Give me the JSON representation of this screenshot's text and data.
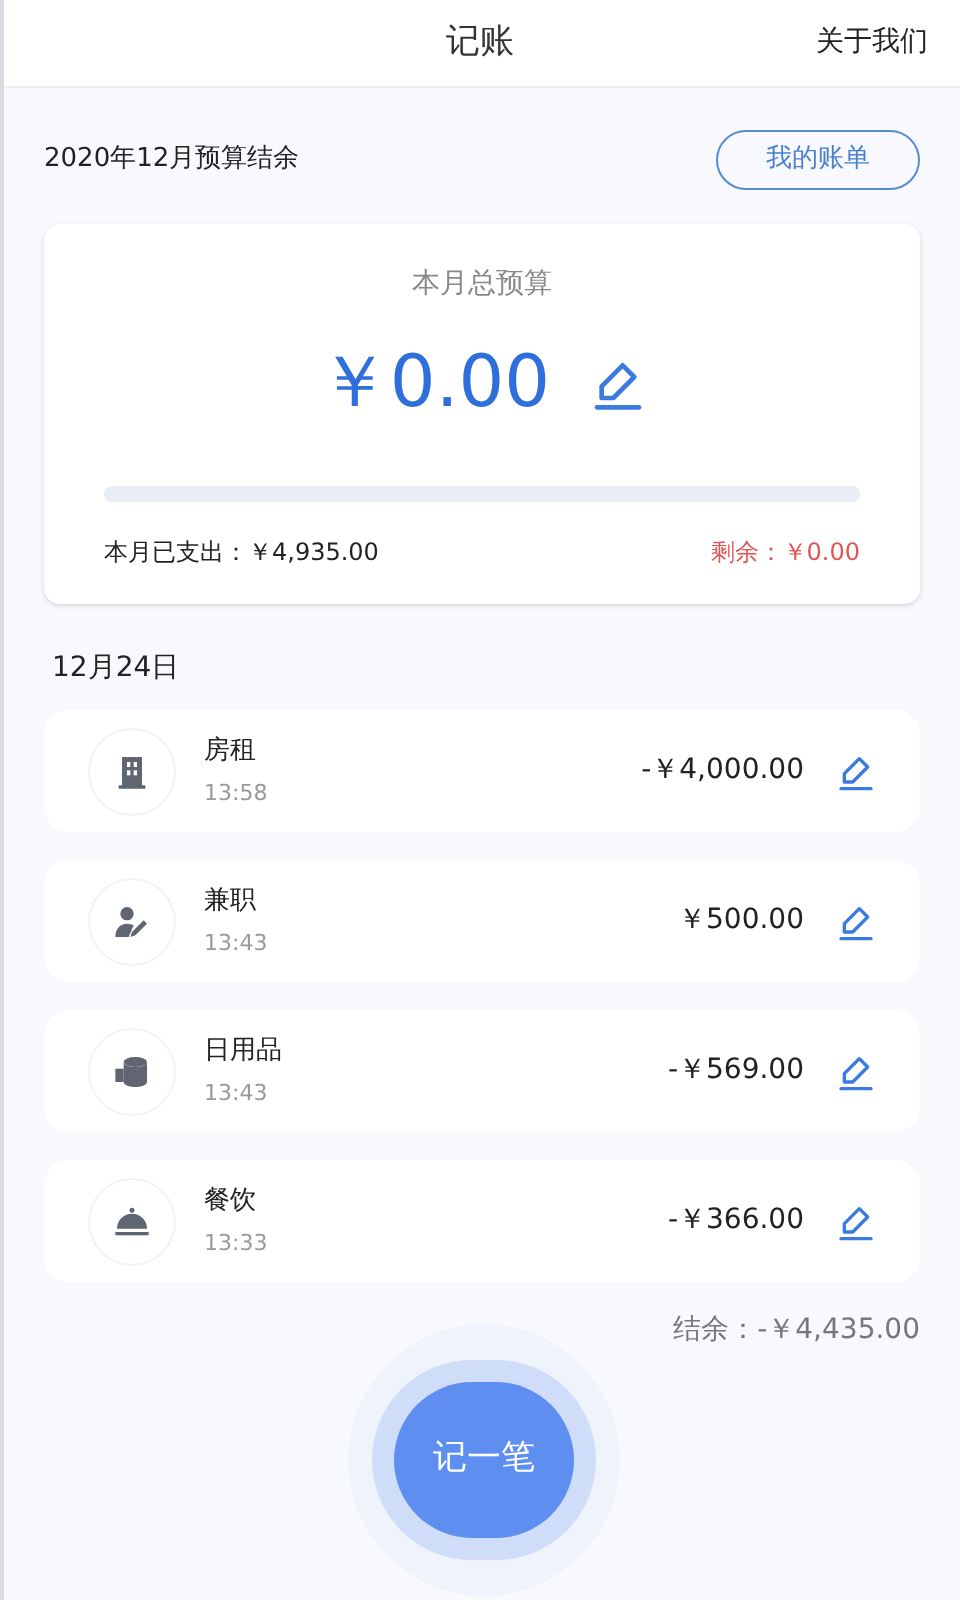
{
  "header": {
    "title": "记账",
    "link": "关于我们"
  },
  "summary": {
    "title": "2020年12月预算结余",
    "bills_button": "我的账单"
  },
  "budget": {
    "label": "本月总预算",
    "amount": "￥0.00",
    "level": 0,
    "spent": "本月已支出：￥4,935.00",
    "remaining": "剩余：￥0.00"
  },
  "day": {
    "date": "12月24日",
    "entries": [
      {
        "kind": "building",
        "name": "房租",
        "time": "13:58",
        "amount": "-￥4,000.00"
      },
      {
        "kind": "person",
        "name": "兼职",
        "time": "13:43",
        "amount": "￥500.00"
      },
      {
        "kind": "roll",
        "name": "日用品",
        "time": "13:43",
        "amount": "-￥569.00"
      },
      {
        "kind": "cloche",
        "name": "餐饮",
        "time": "13:33",
        "amount": "-￥366.00"
      }
    ],
    "balance": "结余：-￥4,435.00"
  },
  "add_button": "记一笔"
}
